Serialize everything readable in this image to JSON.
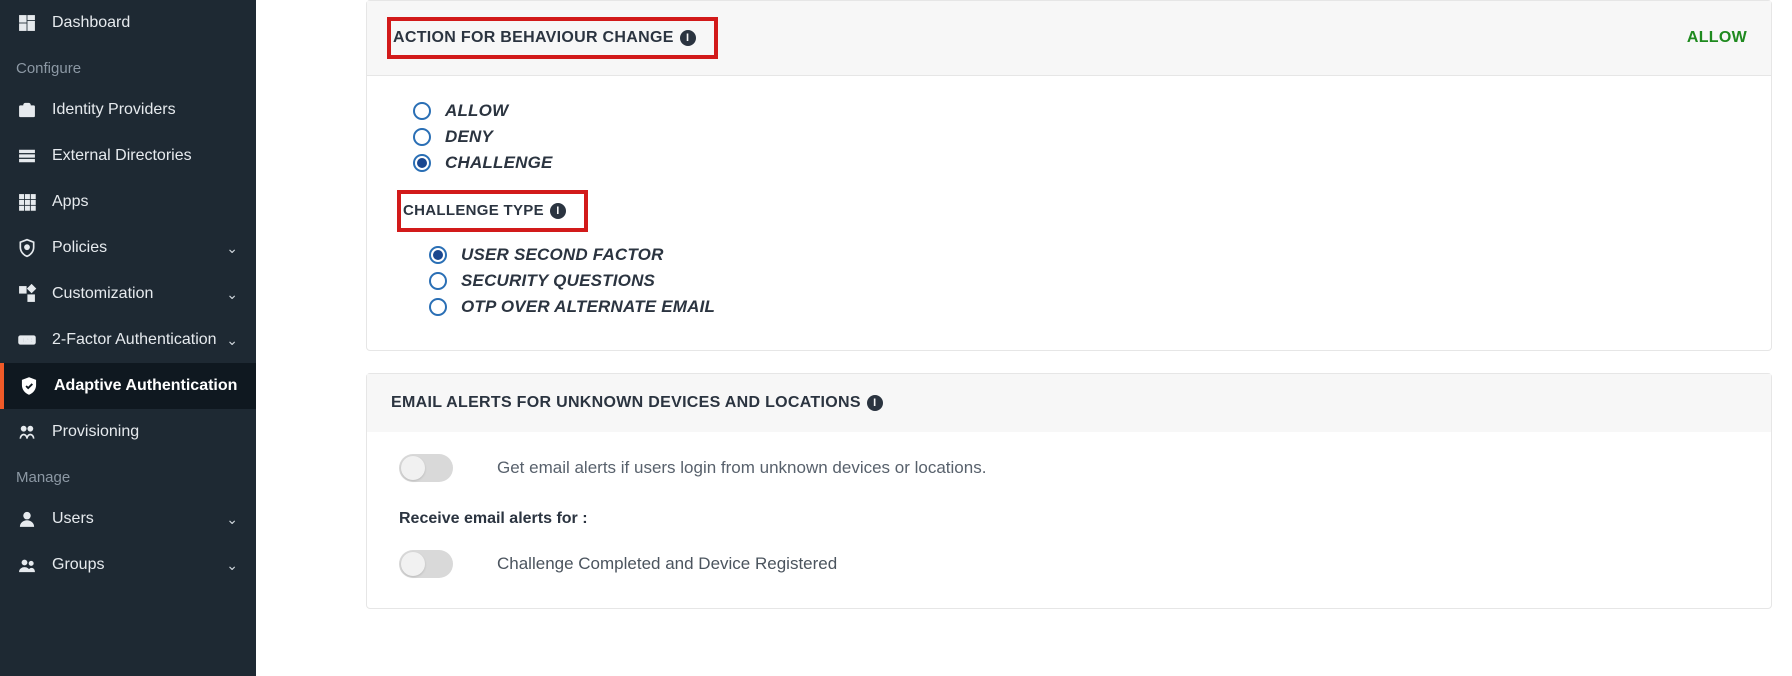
{
  "sidebar": {
    "items": [
      {
        "label": "Dashboard",
        "icon": "dashboard",
        "chevron": false
      },
      {
        "section": "Configure"
      },
      {
        "label": "Identity Providers",
        "icon": "briefcase",
        "chevron": false
      },
      {
        "label": "External Directories",
        "icon": "list",
        "chevron": false
      },
      {
        "label": "Apps",
        "icon": "grid",
        "chevron": false
      },
      {
        "label": "Policies",
        "icon": "shield-q",
        "chevron": true
      },
      {
        "label": "Customization",
        "icon": "widgets",
        "chevron": true
      },
      {
        "label": "2-Factor Authentication",
        "icon": "123",
        "chevron": true
      },
      {
        "label": "Adaptive Authentication",
        "icon": "shield-check",
        "chevron": false,
        "active": true
      },
      {
        "label": "Provisioning",
        "icon": "users-swap",
        "chevron": false
      },
      {
        "section": "Manage"
      },
      {
        "label": "Users",
        "icon": "user",
        "chevron": true
      },
      {
        "label": "Groups",
        "icon": "group",
        "chevron": true
      }
    ]
  },
  "panel1": {
    "title": "ACTION FOR BEHAVIOUR CHANGE",
    "status": "ALLOW",
    "actions": [
      {
        "label": "ALLOW",
        "selected": false
      },
      {
        "label": "DENY",
        "selected": false
      },
      {
        "label": "CHALLENGE",
        "selected": true
      }
    ],
    "challenge_heading": "CHALLENGE TYPE",
    "challenge_types": [
      {
        "label": "USER SECOND FACTOR",
        "selected": true
      },
      {
        "label": "SECURITY QUESTIONS",
        "selected": false
      },
      {
        "label": "OTP OVER ALTERNATE EMAIL",
        "selected": false
      }
    ]
  },
  "panel2": {
    "title": "EMAIL ALERTS FOR UNKNOWN DEVICES AND LOCATIONS",
    "toggle1_text": "Get email alerts if users login from unknown devices or locations.",
    "receive_heading": "Receive email alerts for :",
    "toggle2_text": "Challenge Completed and Device Registered"
  }
}
